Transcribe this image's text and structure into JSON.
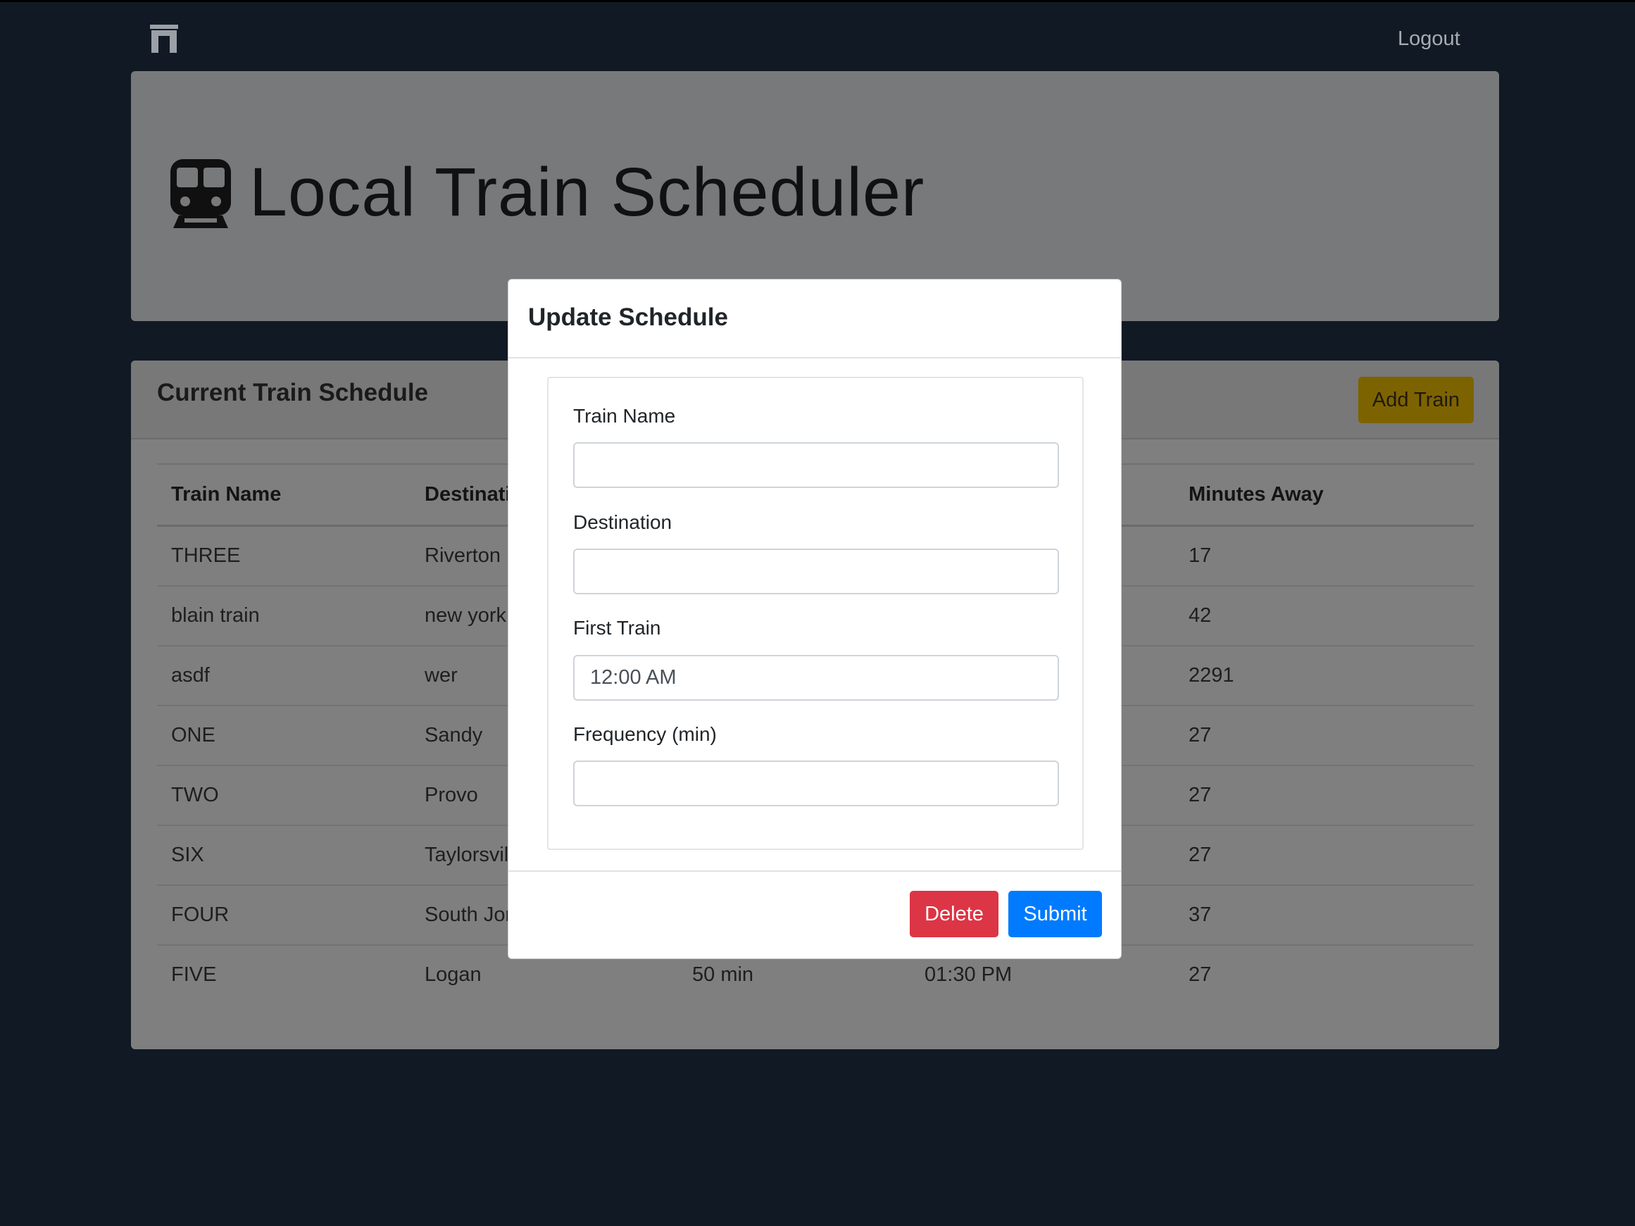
{
  "nav": {
    "brand_icon": "archway-icon",
    "logout": "Logout"
  },
  "jumbotron": {
    "icon": "subway-icon",
    "title": "Local Train Scheduler"
  },
  "schedule": {
    "title": "Current Train Schedule",
    "add_button": "Add Train",
    "columns": [
      "Train Name",
      "Destinati",
      "",
      "",
      "Minutes Away"
    ],
    "rows": [
      [
        "THREE",
        "Riverton",
        "",
        "",
        "17"
      ],
      [
        "blain train",
        "new york",
        "",
        "",
        "42"
      ],
      [
        "asdf",
        "wer",
        "",
        "",
        "2291"
      ],
      [
        "ONE",
        "Sandy",
        "",
        "",
        "27"
      ],
      [
        "TWO",
        "Provo",
        "",
        "",
        "27"
      ],
      [
        "SIX",
        "Taylorsvill",
        "",
        "",
        "27"
      ],
      [
        "FOUR",
        "South Jor",
        "",
        "",
        "37"
      ],
      [
        "FIVE",
        "Logan",
        "50 min",
        "01:30 PM",
        "27"
      ]
    ]
  },
  "modal": {
    "title": "Update Schedule",
    "fields": {
      "train_name": {
        "label": "Train Name",
        "value": ""
      },
      "destination": {
        "label": "Destination",
        "value": ""
      },
      "first_train": {
        "label": "First Train",
        "value": "12:00 AM"
      },
      "frequency": {
        "label": "Frequency (min)",
        "value": ""
      }
    },
    "delete_button": "Delete",
    "submit_button": "Submit"
  },
  "colors": {
    "background": "#111924",
    "delete": "#dc3545",
    "submit": "#007bff",
    "add_train": "#7d6300"
  }
}
